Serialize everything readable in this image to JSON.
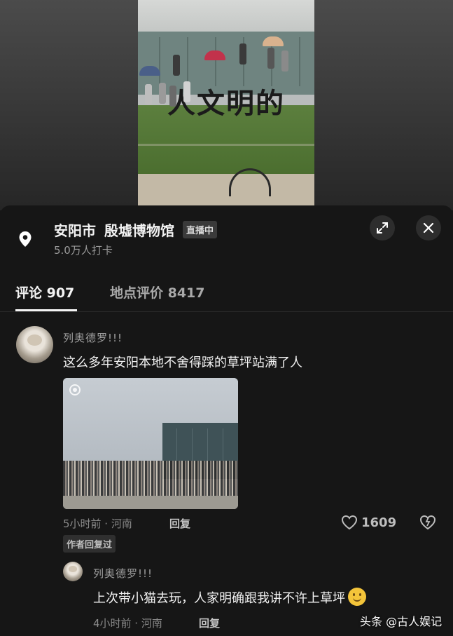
{
  "location": {
    "city": "安阳市",
    "place": "殷墟博物馆",
    "badge": "直播中",
    "checkins": "5.0万人打卡"
  },
  "tabs": [
    {
      "label": "评论 907",
      "active": true
    },
    {
      "label": "地点评价 8417",
      "active": false
    }
  ],
  "video_overlay_text": "人文明的",
  "comment": {
    "author": "列奥德罗!!!",
    "text": "这么多年安阳本地不舍得踩的草坪站满了人",
    "meta": "5小时前 · 河南",
    "reply_label": "回复",
    "likes": "1609",
    "author_replied_badge": "作者回复过"
  },
  "reply": {
    "author": "列奥德罗!!!",
    "text": "上次带小猫去玩，人家明确跟我讲不许上草坪",
    "meta": "4小时前 · 河南",
    "reply_label": "回复"
  },
  "watermark": "头条 @古人娱记",
  "colors": {
    "background": "#161616",
    "text_primary": "#f2f2f2",
    "text_secondary": "#9e9e9e"
  }
}
